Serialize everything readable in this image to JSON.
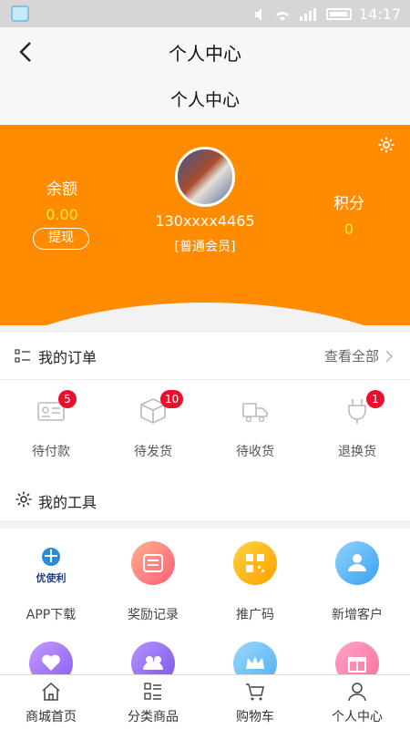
{
  "statusbar": {
    "time": "14:17"
  },
  "navbar": {
    "title": "个人中心"
  },
  "subheader": {
    "title": "个人中心"
  },
  "profile": {
    "balance_label": "余额",
    "balance_value": "0.00",
    "withdraw_label": "提现",
    "phone": "130xxxx4465",
    "member_level": "[普通会员]",
    "points_label": "积分",
    "points_value": "0",
    "accent_color": "#ff8c00",
    "value_color": "#ffe74a"
  },
  "orders": {
    "title": "我的订单",
    "view_all": "查看全部",
    "items": [
      {
        "label": "待付款",
        "badge": "5",
        "icon": "payment-card-icon"
      },
      {
        "label": "待发货",
        "badge": "10",
        "icon": "package-box-icon"
      },
      {
        "label": "待收货",
        "badge": "",
        "icon": "delivery-truck-icon"
      },
      {
        "label": "退换货",
        "badge": "1",
        "icon": "plug-return-icon"
      }
    ]
  },
  "tools": {
    "title": "我的工具",
    "items": [
      {
        "label": "APP下载",
        "icon": "app-logo-icon",
        "logo_text": "优使利"
      },
      {
        "label": "奖励记录",
        "icon": "reward-record-icon"
      },
      {
        "label": "推广码",
        "icon": "qr-code-icon"
      },
      {
        "label": "新增客户",
        "icon": "new-customer-icon"
      },
      {
        "label": "",
        "icon": "heart-icon"
      },
      {
        "label": "",
        "icon": "team-icon"
      },
      {
        "label": "",
        "icon": "crown-icon"
      },
      {
        "label": "",
        "icon": "gift-icon"
      }
    ]
  },
  "tabbar": {
    "items": [
      {
        "label": "商城首页",
        "icon": "home-icon"
      },
      {
        "label": "分类商品",
        "icon": "category-icon"
      },
      {
        "label": "购物车",
        "icon": "cart-icon"
      },
      {
        "label": "个人中心",
        "icon": "user-icon"
      }
    ]
  }
}
